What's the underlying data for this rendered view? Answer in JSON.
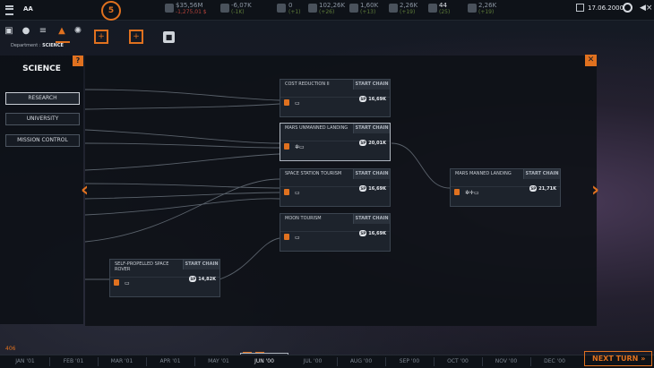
{
  "topbar": {
    "company": "AA",
    "logo_text": "5",
    "money": {
      "main": "$35,56M",
      "sub": "-1,275,01 $"
    },
    "delta": {
      "main": "-6,07K",
      "sub": "(-1K)"
    },
    "stat1": {
      "main": "0",
      "sub": "(+1)"
    },
    "stat2": {
      "main": "102,26K",
      "sub": "(+26)"
    },
    "stat3": {
      "main": "1,60K",
      "sub": "(+13)"
    },
    "stat4": {
      "main": "2,26K",
      "sub": "(+19)"
    },
    "employees": {
      "main": "44",
      "sub": "(25)"
    },
    "stat5": {
      "main": "2,26K",
      "sub": "(+19)"
    },
    "date": "17.06.2000"
  },
  "department": {
    "prefix": "Department :",
    "name": "SCIENCE"
  },
  "sidebar": {
    "title": "SCIENCE",
    "help": "?",
    "items": [
      {
        "label": "RESEARCH",
        "active": true
      },
      {
        "label": "UNIVERSITY",
        "active": false
      },
      {
        "label": "MISSION CONTROL",
        "active": false
      }
    ]
  },
  "nodes": [
    {
      "name": "COST REDUCTION II",
      "start": "START CHAIN",
      "sp": "16,69K"
    },
    {
      "name": "MARS UNMANNED LANDING",
      "start": "START CHAIN",
      "sp": "20,01K"
    },
    {
      "name": "SPACE STATION TOURISM",
      "start": "START CHAIN",
      "sp": "16,69K"
    },
    {
      "name": "MOON TOURISM",
      "start": "START CHAIN",
      "sp": "16,69K"
    },
    {
      "name": "SELF-PROPELLED SPACE ROVER",
      "start": "START CHAIN",
      "sp": "14,82K"
    },
    {
      "name": "MARS MANNED LANDING",
      "start": "START CHAIN",
      "sp": "21,71K"
    }
  ],
  "sp_label": "SP",
  "close": "✕",
  "counter": "406",
  "timeline": {
    "months": [
      "JAN '01",
      "FEB '01",
      "MAR '01",
      "APR '01",
      "MAY '01",
      "JUN '00",
      "JUL '00",
      "AUG '00",
      "SEP '00",
      "OCT '00",
      "NOV '00",
      "DEC '00"
    ],
    "current_index": 5
  },
  "next_turn": "NEXT TURN",
  "colors": {
    "accent": "#e0711f",
    "bg": "#0d1016"
  }
}
